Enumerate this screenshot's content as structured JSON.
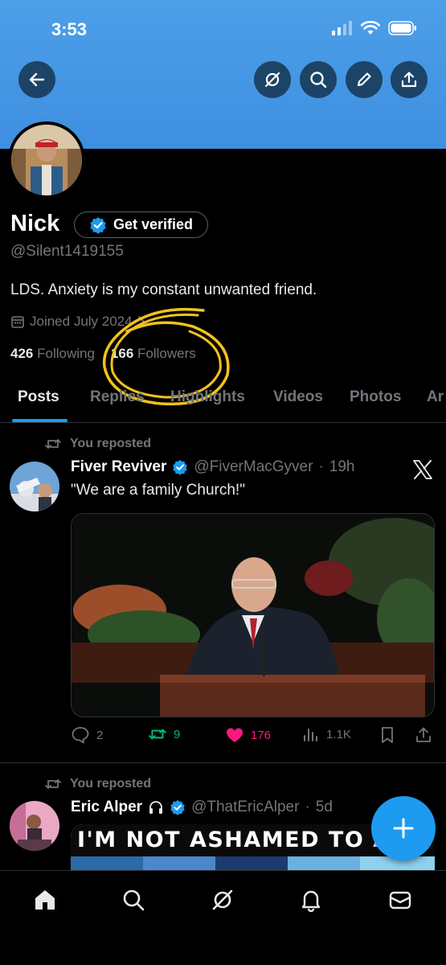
{
  "status_bar": {
    "time": "3:53"
  },
  "header": {
    "back_icon": "arrow-left-icon",
    "grok_icon": "grok-icon",
    "search_icon": "search-icon",
    "compose_icon": "pencil-icon",
    "share_icon": "share-icon",
    "banner_color": "#4d9fe8"
  },
  "profile": {
    "name": "Nick",
    "verify_button_label": "Get verified",
    "handle": "@Silent1419155",
    "bio": "LDS. Anxiety is my constant unwanted friend.",
    "joined": "Joined July 2024",
    "following_count": "426",
    "following_label": "Following",
    "followers_count": "166",
    "followers_label": "Followers"
  },
  "tabs": [
    {
      "label": "Posts",
      "active": true
    },
    {
      "label": "Replies"
    },
    {
      "label": "Highlights"
    },
    {
      "label": "Videos"
    },
    {
      "label": "Photos"
    },
    {
      "label": "Ar"
    }
  ],
  "posts": [
    {
      "repost_label": "You reposted",
      "author": "Fiver Reviver",
      "handle": "@FiverMacGyver",
      "time": "19h",
      "text": "\"We are a family Church!\"",
      "replies": "2",
      "reposts": "9",
      "likes": "176",
      "views": "1.1K"
    },
    {
      "repost_label": "You reposted",
      "author": "Eric Alper",
      "handle": "@ThatEricAlper",
      "time": "5d",
      "media_text": "I'M NOT ASHAMED TO AD"
    }
  ],
  "accent_color": "#1d9bf0",
  "like_color": "#f91880",
  "repost_color": "#00ba7c"
}
